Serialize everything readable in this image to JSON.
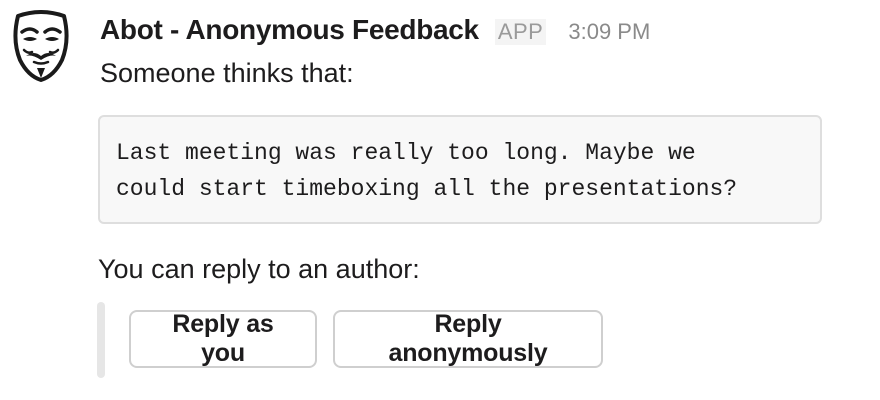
{
  "message": {
    "sender": "Abot - Anonymous Feedback",
    "badge": "APP",
    "time": "3:09 PM",
    "intro": "Someone thinks that:",
    "quote": "Last meeting was really too long. Maybe we\ncould start timeboxing all the presentations?",
    "reply_prompt": "You can reply to an author:",
    "avatar_icon": "anonymous-mask-icon"
  },
  "actions": {
    "reply_as_you": "Reply as you",
    "reply_anonymously": "Reply anonymously"
  }
}
